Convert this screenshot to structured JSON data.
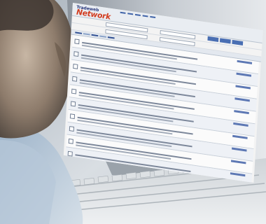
{
  "app": {
    "logo_small": "Tradeweb",
    "logo_big": "Network"
  },
  "photo": {
    "subject": "person-looking-at-monitor",
    "objects": [
      "crt-monitor",
      "keyboard",
      "person"
    ]
  },
  "colors": {
    "accent": "#3f63a8",
    "logo_red": "#d23c1f",
    "screen_bg": "#f3f3f3"
  }
}
